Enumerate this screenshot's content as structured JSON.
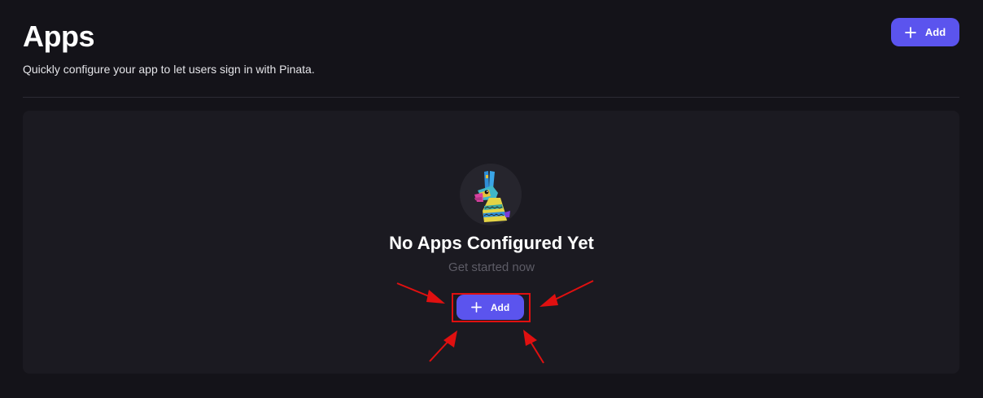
{
  "header": {
    "title": "Apps",
    "subtitle": "Quickly configure your app to let users sign in with Pinata.",
    "add_label": "Add"
  },
  "empty_state": {
    "illustration": "pinata-llama-mascot",
    "title": "No Apps Configured Yet",
    "subtitle": "Get started now",
    "add_label": "Add"
  },
  "icons": {
    "add": "plus-icon"
  },
  "colors": {
    "background": "#141319",
    "card": "#1b1a21",
    "accent": "#5b54ee",
    "annotation": "#e01010"
  }
}
